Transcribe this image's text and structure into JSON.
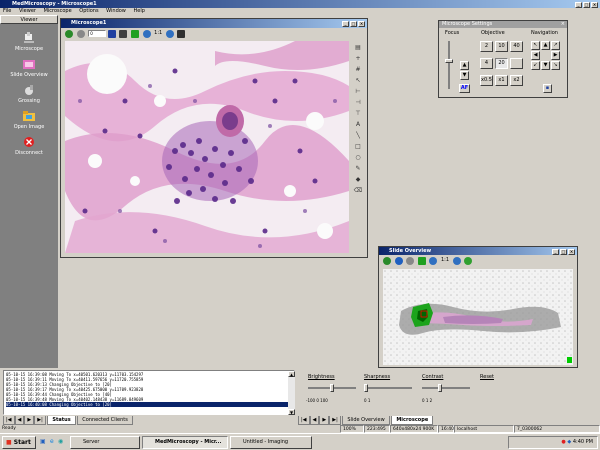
{
  "app": {
    "title": "MedMicroscopy - Microscope1",
    "menu": [
      "File",
      "Viewer",
      "Microscope",
      "Options",
      "Window",
      "Help"
    ]
  },
  "sidebar": {
    "tab": "Viewer",
    "items": [
      {
        "label": "Microscope",
        "icon": "microscope-icon"
      },
      {
        "label": "Slide Overview",
        "icon": "slide-overview-icon"
      },
      {
        "label": "Grossing",
        "icon": "grossing-icon"
      },
      {
        "label": "Open Image",
        "icon": "folder-icon"
      },
      {
        "label": "Disconnect",
        "icon": "disconnect-icon"
      }
    ]
  },
  "microscope_window": {
    "title": "Microscope1",
    "zoom_value": "0",
    "zoom_label": "1:1"
  },
  "settings": {
    "title": "Microscope Settings",
    "focus_label": "Focus",
    "objective_label": "Objective",
    "navigation_label": "Navigation",
    "objectives": [
      "2",
      "10",
      "40",
      "4",
      "20",
      "x0.5",
      "x1",
      "x2"
    ],
    "auto_label": "AF"
  },
  "slide_window": {
    "title": "Slide Overview",
    "zoom_label": "1:1"
  },
  "log": {
    "lines": [
      "05-10-15 16:39:08 Moving To x=40501.620313 y=11703.154297",
      "05-10-15 16:39:11 Moving To x=40411.597656 y=11720.755859",
      "05-10-15 16:39:13 Changing Objective to [20]",
      "05-10-15 16:39:17 Moving To x=40425.675000 y=11709.923828",
      "05-10-15 16:39:44 Changing Objective to [40]",
      "05-10-15 16:39:48 Moving To x=40402.148438 y=11689.849609",
      "05-10-15 16:40:08 Changing Objective to [20]"
    ],
    "selected_index": 6,
    "tabs": [
      "Status",
      "Connected Clients"
    ]
  },
  "controls": {
    "brightness_label": "Brightness",
    "sharpness_label": "Sharpness",
    "contrast_label": "Contrast",
    "reset_label": "Reset",
    "brightness_ticks": "-100   0   100",
    "sharpness_ticks": "0        1",
    "contrast_ticks": "0    1    2",
    "tabs": [
      "Slide Overview",
      "Microscope"
    ]
  },
  "statusbar": {
    "ready": "Ready",
    "zoom": "100%",
    "coords": "223:495",
    "resolution": "640x480x24 900K",
    "time": "16:40",
    "host": "localhost",
    "code": "7_0300062"
  },
  "taskbar": {
    "start": "Start",
    "tasks": [
      "Server",
      "MedMicroscopy - Micr...",
      "Untitled - Imaging"
    ],
    "clock": "4:40 PM"
  },
  "colors": {
    "titlebar": "#0a246a",
    "tissue_pink": "#d88fbf",
    "nuclei_purple": "#5a2a8a",
    "overview_highlight": "#00cc00"
  }
}
